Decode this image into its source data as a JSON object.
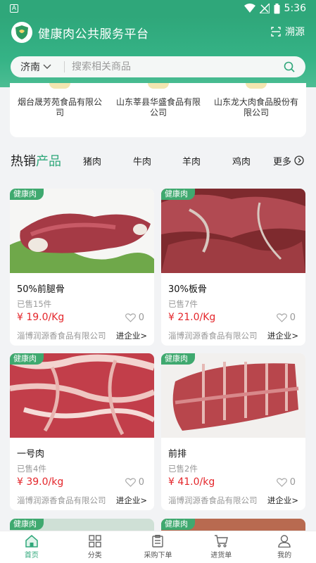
{
  "status_bar": {
    "notification": "A",
    "time": "5:36"
  },
  "header": {
    "title": "健康肉公共服务平台",
    "trace_label": "溯源"
  },
  "search": {
    "city": "济南",
    "placeholder": "搜索相关商品"
  },
  "companies": [
    {
      "name": "烟台晟芳苑食品有限公司"
    },
    {
      "name": "山东莘县华盛食品有限公司"
    },
    {
      "name": "山东龙大肉食品股份有限公司"
    }
  ],
  "hot": {
    "title_a": "热销",
    "title_b": "产品",
    "tabs": [
      "猪肉",
      "牛肉",
      "羊肉",
      "鸡肉"
    ],
    "more": "更多"
  },
  "products": [
    {
      "badge": "健康肉",
      "name": "50%前腿骨",
      "sold": "已售15件",
      "price": "¥ 19.0/Kg",
      "likes": "0",
      "seller": "淄博润源香食品有限公司",
      "enter": "进企业>"
    },
    {
      "badge": "健康肉",
      "name": "30%板骨",
      "sold": "已售7件",
      "price": "¥ 21.0/Kg",
      "likes": "0",
      "seller": "淄博润源香食品有限公司",
      "enter": "进企业>"
    },
    {
      "badge": "健康肉",
      "name": "一号肉",
      "sold": "已售4件",
      "price": "¥ 39.0/kg",
      "likes": "0",
      "seller": "淄博润源香食品有限公司",
      "enter": "进企业>"
    },
    {
      "badge": "健康肉",
      "name": "前排",
      "sold": "已售2件",
      "price": "¥ 41.0/kg",
      "likes": "0",
      "seller": "淄博润源香食品有限公司",
      "enter": "进企业>"
    }
  ],
  "peek_badges": [
    "健康肉",
    "健康肉"
  ],
  "nav": [
    {
      "label": "首页",
      "icon": "home-icon",
      "active": true
    },
    {
      "label": "分类",
      "icon": "category-icon"
    },
    {
      "label": "采购下单",
      "icon": "order-icon"
    },
    {
      "label": "进货单",
      "icon": "cart-icon"
    },
    {
      "label": "我的",
      "icon": "profile-icon"
    }
  ],
  "colors": {
    "brand": "#2fa77a",
    "price": "#e4262b",
    "badge": "#3fa96f"
  }
}
